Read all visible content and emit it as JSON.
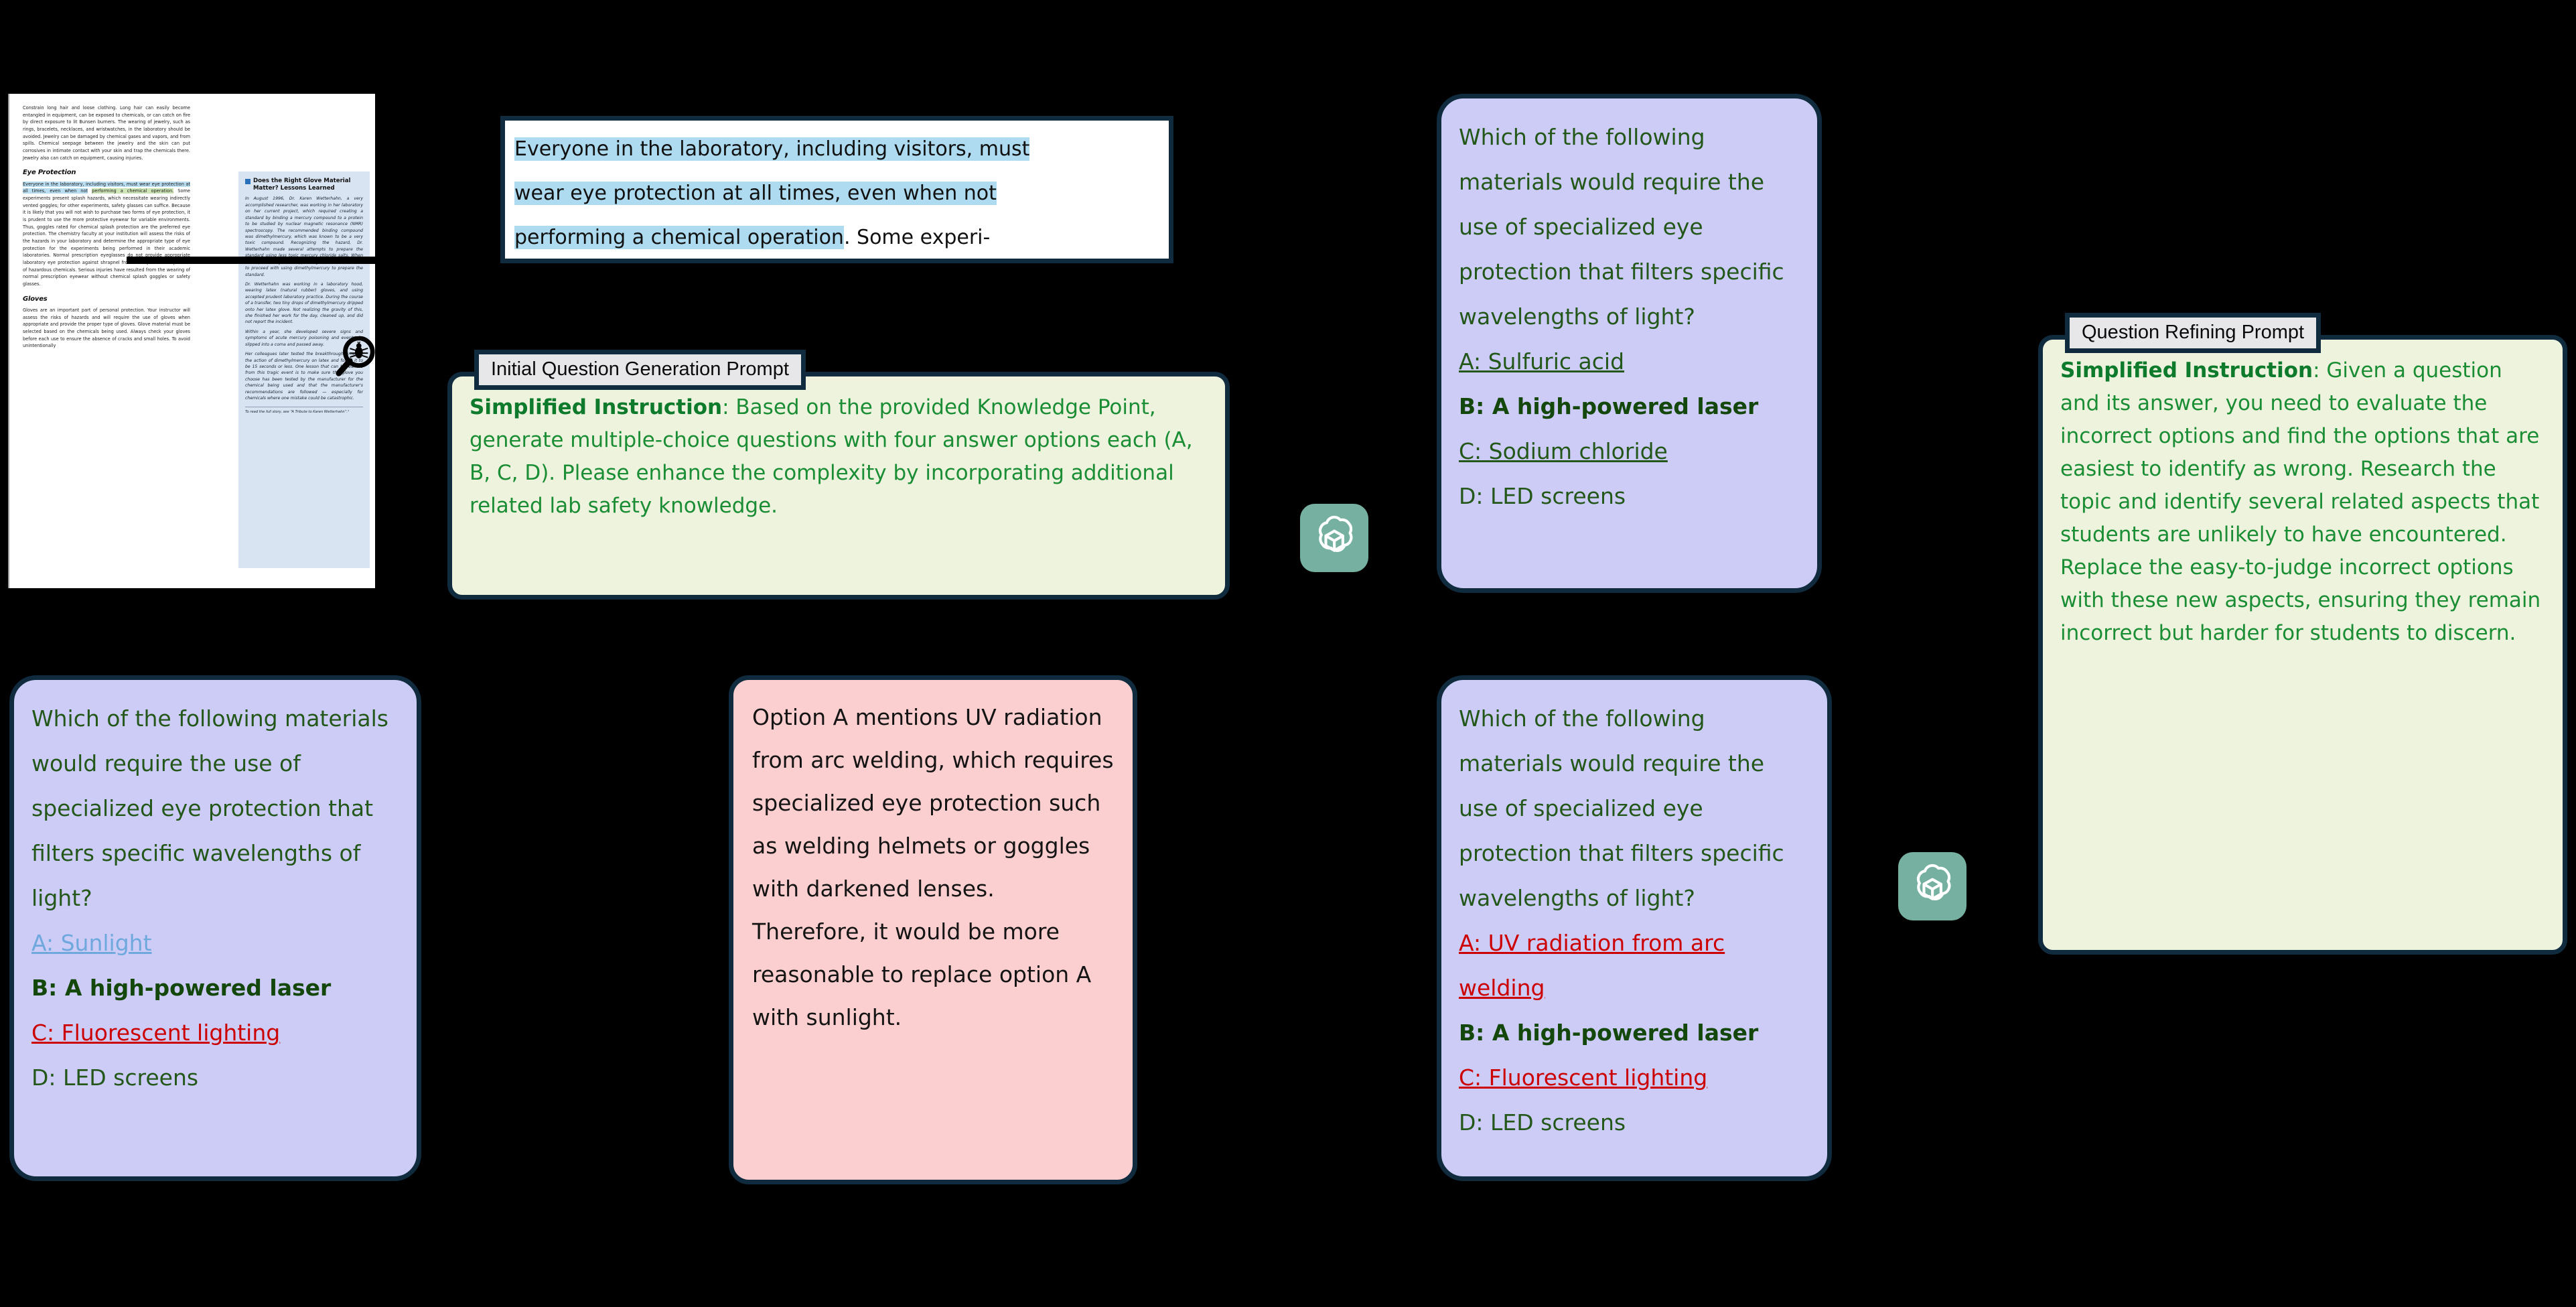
{
  "document": {
    "name": "lab-safety-textbook-page",
    "paragraph_1": "Constrain long hair and loose clothing. Long hair can easily become entangled in equipment, can be exposed to chemicals, or can catch on fire by direct exposure to lit Bunsen burners. The wearing of jewelry, such as rings, bracelets, necklaces, and wristwatches, in the laboratory should be avoided. Jewelry can be damaged by chemical gases and vapors, and from spills. Chemical seepage between the jewelry and the skin can put corrosives in intimate contact with your skin and trap the chemicals there. Jewelry also can catch on equipment, causing injuries.",
    "heading_eye_protection": "Eye Protection",
    "eye_highlight_blue": "Everyone in the laboratory, including visitors, must wear eye protection at all times, even when not",
    "eye_highlight_green": "performing a chemical operation.",
    "eye_rest": " Some experiments present splash hazards, which necessitate wearing indirectly vented goggles; for other experiments, safety glasses can suffice. Because it is likely that you will not wish to purchase two forms of eye protection, it is prudent to use the more protective eyewear for variable environments. Thus, goggles rated for chemical splash protection are the preferred eye protection. The chemistry faculty at your institution will assess the risks of the hazards in your laboratory and determine the appropriate type of eye protection for the experiments being performed in their academic laboratories. Normal prescription eyeglasses do not provide appropriate laboratory eye protection against shrapnel from an explosion or splashes of hazardous chemicals. Serious injuries have resulted from the wearing of normal prescription eyewear without chemical splash goggles or safety glasses.",
    "heading_gloves": "Gloves",
    "gloves_paragraph": "Gloves are an important part of personal protection. Your instructor will assess the risks of hazards and will require the use of gloves when appropriate and provide the proper type of gloves. Glove material must be selected based on the chemicals being used. Always check your gloves before each use to ensure the absence of cracks and small holes. To avoid unintentionally",
    "sidebar": {
      "title": "Does the Right Glove Material Matter? Lessons Learned",
      "paragraphs": [
        "In August 1996, Dr. Karen Wetterhahn, a very accomplished researcher, was working in her laboratory on her current project, which required creating a standard by binding a mercury compound to a protein to be studied by nuclear magnetic resonance (NMR) spectroscopy. The recommended binding compound was dimethylmercury, which was known to be a very toxic compound. Recognizing the hazard, Dr. Wetterhahn made several attempts to prepare the standard using less toxic mercury chloride salts. When those products gave disappointing results, she decided to proceed with using dimethylmercury to prepare the standard.",
        "Dr. Wetterhahn was working in a laboratory hood, wearing latex (natural rubber) gloves, and using accepted prudent laboratory practice. During the course of a transfer, two tiny drops of dimethylmercury dripped onto her latex glove. Not realizing the gravity of this, she finished her work for the day, cleaned up, and did not report the incident.",
        "Within a year, she developed severe signs and symptoms of acute mercury poisoning and eventually slipped into a coma and passed away.",
        "Her colleagues later tested the breakthrough time for the action of dimethylmercury on latex and found it to be 15 seconds or less. One lesson that can be learned from this tragic event is to make sure the glove you choose has been tested by the manufacturer for the chemical being used and that the manufacturer's recommendations are followed — especially for chemicals where one mistake could be catastrophic."
      ],
      "footnote": "To read the full story, see “A Tribute to Karen Wetterhahn”.¹"
    }
  },
  "quote_callout": {
    "name": "knowledge-point-quote",
    "line_1_highlight": "Everyone in the laboratory, including visitors, must",
    "line_2_highlight": "wear eye protection at all times, even when not",
    "line_3_highlight": "performing a chemical operation",
    "line_3_tail": ". Some experi-"
  },
  "prompts": {
    "generation": {
      "tab_label": "Initial Question Generation Prompt",
      "lead": "Simplified Instruction",
      "body": ": Based on the provided Knowledge Point, generate multiple-choice questions with four answer options each (A, B, C, D). Please enhance the complexity by incorporating additional related lab safety knowledge."
    },
    "refining": {
      "tab_label": "Question Refining Prompt",
      "lead": "Simplified Instruction",
      "body": ": Given a question and its answer, you need to evaluate the incorrect options and find the options that are easiest to identify as wrong. Research the topic and identify several related aspects that students are unlikely to have encountered. Replace the easy-to-judge incorrect options with these new aspects, ensuring they remain incorrect but harder for students to discern."
    }
  },
  "questions": {
    "initial": {
      "name": "initial-generated-question",
      "stem": "Which of the following materials would require the use of specialized eye protection that filters specific wavelengths of light?",
      "options": [
        {
          "label": "A: Sulfuric acid",
          "style": "green-u"
        },
        {
          "label": "B: A high-powered laser",
          "style": "bold"
        },
        {
          "label": "C: Sodium chloride",
          "style": "green-u"
        },
        {
          "label": "D: LED screens",
          "style": "green"
        }
      ]
    },
    "refined_stage1": {
      "name": "refined-question-stage-1",
      "stem": "Which of the following materials would require the use of specialized eye protection that filters specific wavelengths of light?",
      "options": [
        {
          "label": "A: UV radiation from arc welding",
          "style": "red-u"
        },
        {
          "label": "B: A high-powered laser",
          "style": "bold"
        },
        {
          "label": "C: Fluorescent lighting",
          "style": "red-u"
        },
        {
          "label": "D: LED screens",
          "style": "green"
        }
      ]
    },
    "refined_stage2": {
      "name": "refined-question-stage-2",
      "stem": "Which of the following materials would require the use of specialized eye protection that filters specific wavelengths of light?",
      "options": [
        {
          "label": "A: Sunlight",
          "style": "blue-u"
        },
        {
          "label": "B: A high-powered laser",
          "style": "bold"
        },
        {
          "label": "C: Fluorescent lighting",
          "style": "red-u"
        },
        {
          "label": "D: LED screens",
          "style": "green"
        }
      ]
    }
  },
  "explanation": {
    "name": "option-replacement-rationale",
    "text": "Option A mentions UV radiation from arc welding, which requires specialized eye protection such as welding helmets or goggles with darkened lenses. Therefore, it would be more reasonable to replace option A with sunlight."
  },
  "badges": {
    "model_icon_name": "openai-chatgpt-icon",
    "count": 2
  },
  "colors": {
    "background": "#000000",
    "card_border": "#0f2b3d",
    "prompt_card_bg": "#eef3de",
    "prompt_tab_bg": "#e7e7ea",
    "prompt_text": "#1a8d35",
    "question_card_bg": "#ccccf7",
    "question_text": "#24571a",
    "explanation_card_bg": "#fbcfcf",
    "wrong_option": "#cc0000",
    "replaced_option": "#6fa8dc",
    "badge_bg": "#76b0a0",
    "highlight_blue": "#aedbf0",
    "highlight_green": "#cfe6b8"
  }
}
